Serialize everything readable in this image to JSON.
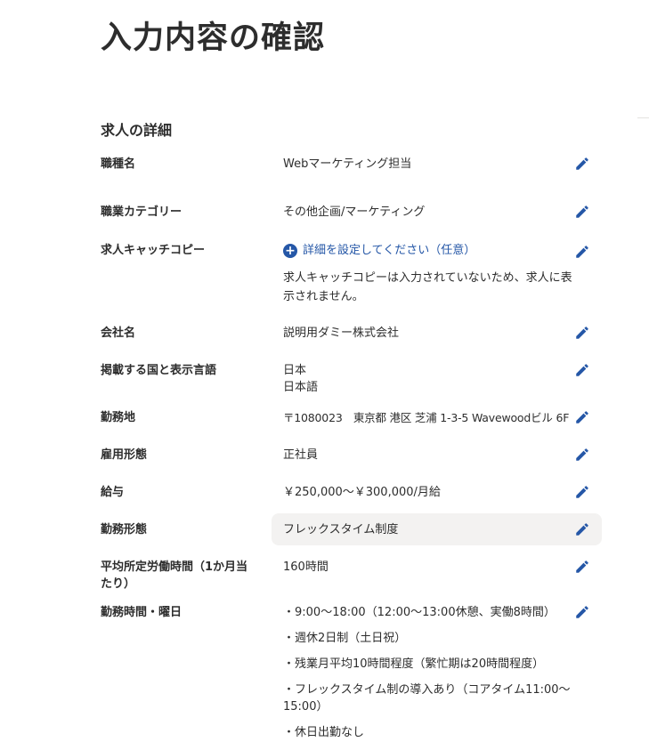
{
  "page": {
    "title": "入力内容の確認"
  },
  "section": {
    "title": "求人の詳細"
  },
  "colors": {
    "accent": "#2557a7",
    "text": "#2d2d2d",
    "highlight_bg": "#f3f2f1"
  },
  "icons": {
    "edit": "pencil-icon",
    "add": "plus-circle-icon"
  },
  "fields": {
    "job_title": {
      "label": "職種名",
      "value": "Webマーケティング担当"
    },
    "job_category": {
      "label": "職業カテゴリー",
      "value": "その他企画/マーケティング"
    },
    "catch_copy": {
      "label": "求人キャッチコピー",
      "link": "詳細を設定してください（任意）",
      "note": "求人キャッチコピーは入力されていないため、求人に表示されません。"
    },
    "company": {
      "label": "会社名",
      "value": "説明用ダミー株式会社"
    },
    "country_language": {
      "label": "掲載する国と表示言語",
      "country": "日本",
      "language": "日本語"
    },
    "location": {
      "label": "勤務地",
      "value": "〒1080023　東京都 港区 芝浦 1-3-5 Wavewoodビル 6F"
    },
    "employment_type": {
      "label": "雇用形態",
      "value": "正社員"
    },
    "salary": {
      "label": "給与",
      "value": "￥250,000～￥300,000/月給"
    },
    "work_style": {
      "label": "勤務形態",
      "value": "フレックスタイム制度"
    },
    "avg_hours": {
      "label": "平均所定労働時間（1か月当たり）",
      "value": "160時間"
    },
    "schedule": {
      "label": "勤務時間・曜日",
      "items": [
        "・9:00～18:00（12:00～13:00休憩、実働8時間）",
        "・週休2日制（土日祝）",
        "・残業月平均10時間程度（繁忙期は20時間程度）",
        "・フレックスタイム制の導入あり（コアタイム11:00～15:00）",
        "・休日出勤なし"
      ]
    }
  }
}
